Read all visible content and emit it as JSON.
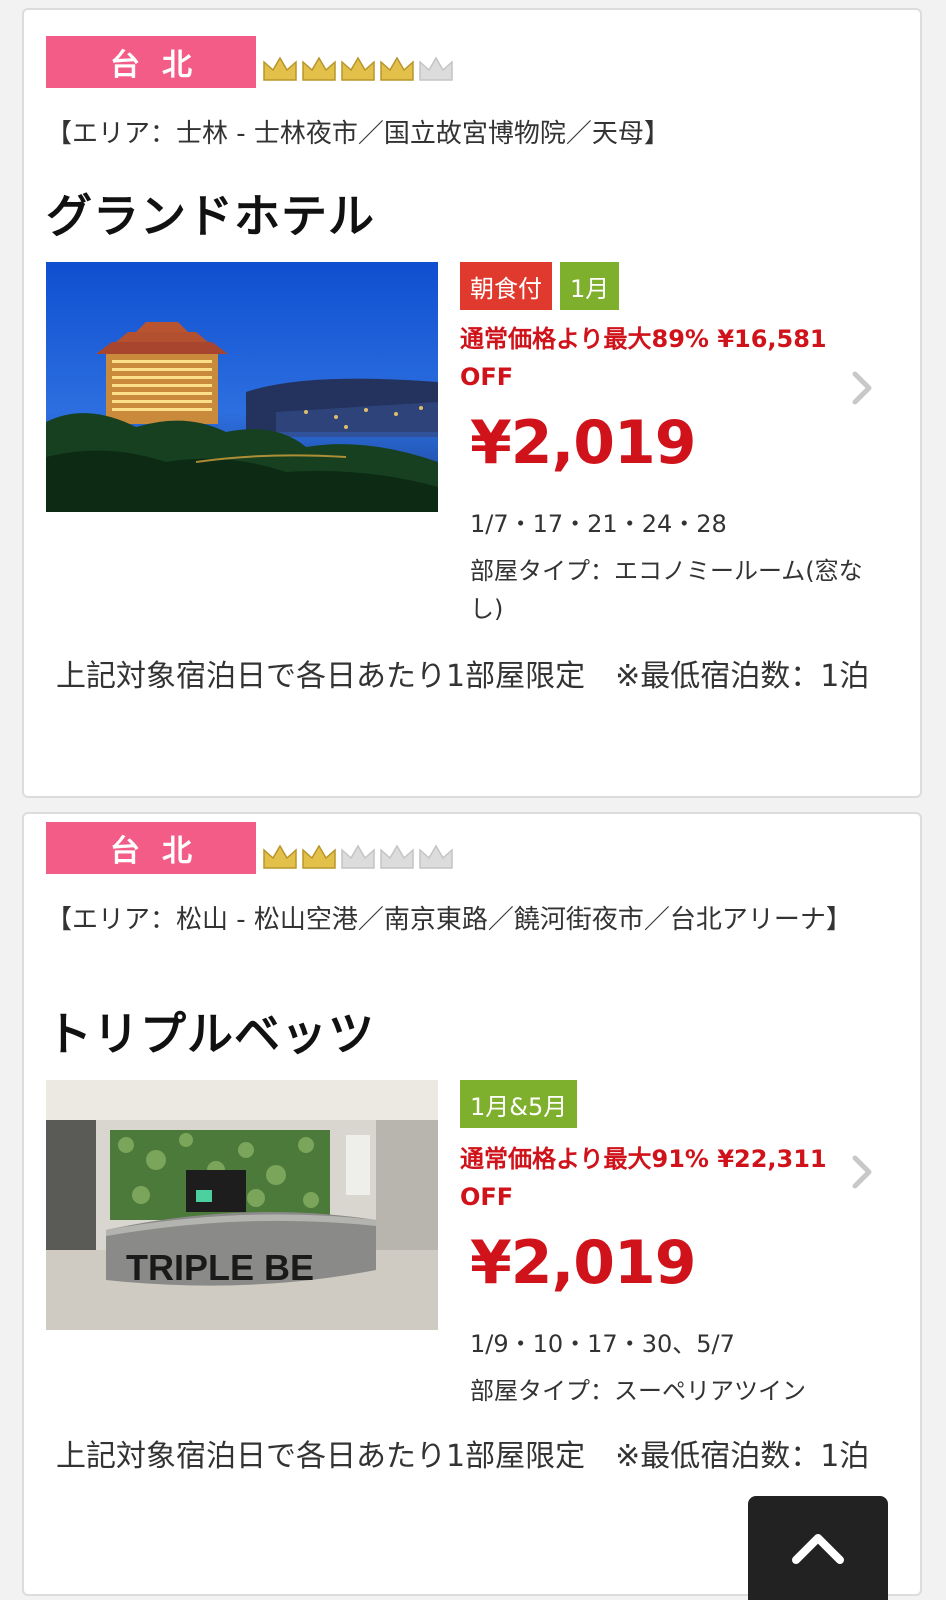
{
  "hotels": [
    {
      "region": "台北",
      "rating": 4,
      "rating_max": 5,
      "area": "【エリア：士林 - 士林夜市／国立故宮博物院／天母】",
      "name": "グランドホテル",
      "tags": [
        {
          "label": "朝食付",
          "color": "#e03a2f"
        },
        {
          "label": "1月",
          "color": "#7fb02d"
        }
      ],
      "discount": "通常価格より最大89% ¥16,581 OFF",
      "price": "¥2,019",
      "dates": "1/7・17・21・24・28",
      "room_type": "部屋タイプ：エコノミールーム(窓なし)",
      "limit": "上記対象宿泊日で各日あたり1部屋限定　※最低宿泊数：1泊"
    },
    {
      "region": "台北",
      "rating": 2,
      "rating_max": 5,
      "area": "【エリア：松山 - 松山空港／南京東路／饒河街夜市／台北アリーナ】",
      "name": "トリプルベッツ",
      "tags": [
        {
          "label": "1月&5月",
          "color": "#7fb02d"
        }
      ],
      "discount": "通常価格より最大91% ¥22,311 OFF",
      "price": "¥2,019",
      "dates": "1/9・10・17・30、5/7",
      "room_type": "部屋タイプ：スーペリアツイン",
      "limit": "上記対象宿泊日で各日あたり1部屋限定　※最低宿泊数：1泊",
      "photo_sign": "TRIPLE BE"
    }
  ],
  "colors": {
    "accent_pink": "#f25c86",
    "price_red": "#d0131b",
    "crown_gold": "#e2c04a",
    "crown_gray": "#dcdcdc"
  },
  "icons": {
    "chevron": "chevron-right-icon",
    "scroll_top": "chevron-up-icon"
  }
}
